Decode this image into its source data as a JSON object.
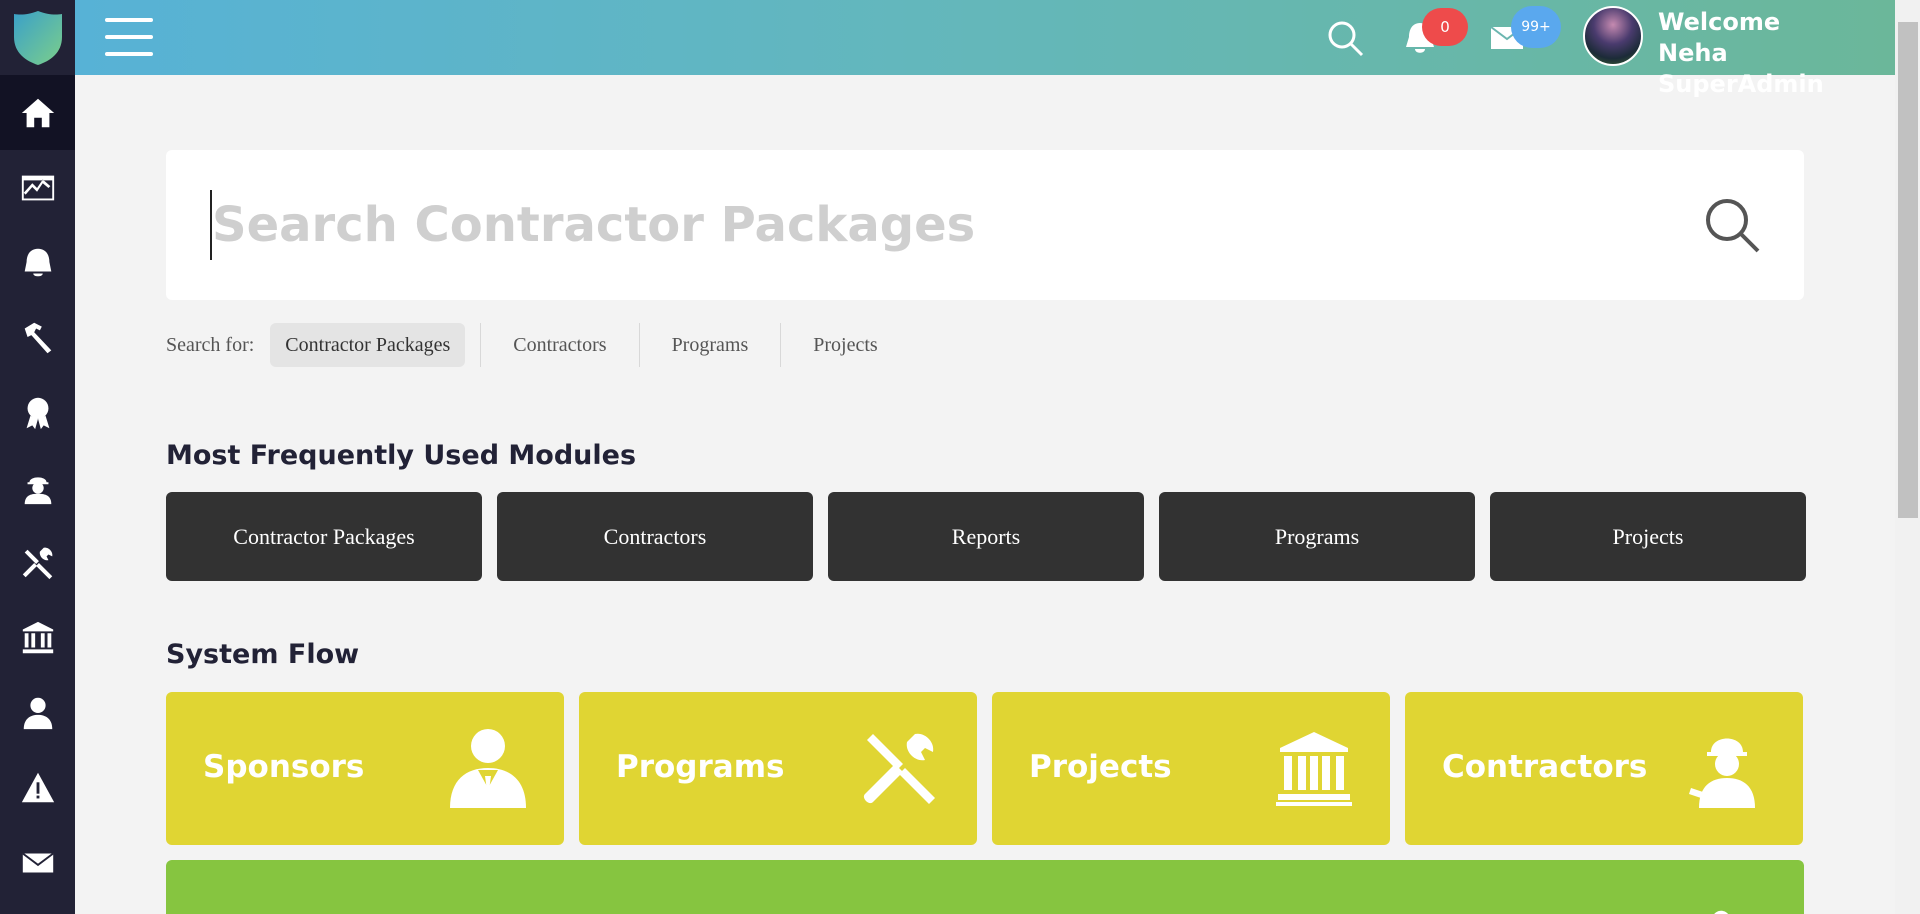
{
  "sidebar": {
    "items": [
      {
        "icon": "home-icon"
      },
      {
        "icon": "dashboard-chart-icon"
      },
      {
        "icon": "bell-icon"
      },
      {
        "icon": "hammer-icon"
      },
      {
        "icon": "award-ribbon-icon"
      },
      {
        "icon": "worker-icon"
      },
      {
        "icon": "tools-icon"
      },
      {
        "icon": "bank-building-icon"
      },
      {
        "icon": "sponsor-user-icon"
      },
      {
        "icon": "warning-icon"
      },
      {
        "icon": "envelope-icon"
      }
    ]
  },
  "header": {
    "notifications_count": "0",
    "messages_count": "99+",
    "welcome_line1": "Welcome",
    "welcome_line2": "Neha SuperAdmin"
  },
  "search": {
    "placeholder": "Search Contractor Packages",
    "value": ""
  },
  "search_for": {
    "label": "Search for:",
    "options": [
      "Contractor Packages",
      "Contractors",
      "Programs",
      "Projects"
    ],
    "selected": "Contractor Packages"
  },
  "modules": {
    "title": "Most Frequently Used Modules",
    "items": [
      "Contractor Packages",
      "Contractors",
      "Reports",
      "Programs",
      "Projects"
    ]
  },
  "system_flow": {
    "title": "System Flow",
    "cards": [
      {
        "label": "Sponsors",
        "icon": "sponsor-user-icon"
      },
      {
        "label": "Programs",
        "icon": "tools-icon"
      },
      {
        "label": "Projects",
        "icon": "bank-building-icon"
      },
      {
        "label": "Contractors",
        "icon": "worker-icon"
      }
    ]
  },
  "colors": {
    "sidebar": "#222236",
    "topbar_start": "#57b2d6",
    "topbar_end": "#6bb79a",
    "flow_card": "#e0d533",
    "green_card": "#86c540",
    "module_button": "#323232",
    "notification_badge": "#ee4b4b",
    "message_badge": "#5aa8ee"
  }
}
